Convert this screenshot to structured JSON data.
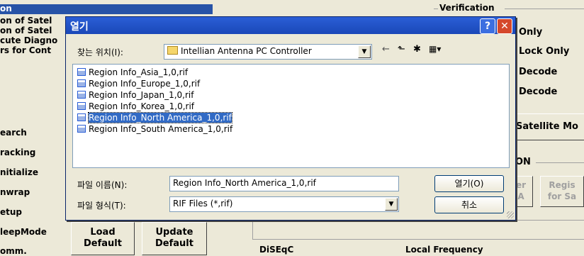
{
  "background": {
    "left_panel": {
      "highlight_text": "on",
      "items": [
        "on of Satel",
        "on of Satel",
        "cute Diagno",
        "rs for Cont",
        "earch",
        "racking",
        "nitialize",
        "nwrap",
        "etup",
        "leepMode",
        "omm."
      ]
    },
    "verification": {
      "group_label": "Verification",
      "options": [
        "Only",
        "Lock Only",
        "Decode",
        "Decode"
      ]
    },
    "satellite_mode_button": "Satellite Mo",
    "on_group_label": "ON",
    "disabled_buttons": [
      {
        "line1": "er",
        "line2": "A"
      },
      {
        "line1": "Regis",
        "line2": "for Sa"
      }
    ],
    "load_default": "Load Default",
    "update_default": "Update Default",
    "diseqc_label": "DiSEqC",
    "local_frequency_label": "Local Frequency"
  },
  "dialog": {
    "title": "열기",
    "help_glyph": "?",
    "close_glyph": "✕",
    "look_in_label": "찾는 위치(I):",
    "look_in_value": "Intellian Antenna PC Controller",
    "toolbar": {
      "back_icon": "←",
      "up_icon": "⬑",
      "new_folder_icon": "✱",
      "view_menu_icon": "▦▾"
    },
    "files": [
      "Region Info_Asia_1,0,rif",
      "Region Info_Europe_1,0,rif",
      "Region Info_Japan_1,0,rif",
      "Region Info_Korea_1,0,rif",
      "Region Info_North America_1,0,rif",
      "Region Info_South America_1,0,rif"
    ],
    "selected_index": 4,
    "filename_label": "파일 이름(N):",
    "filename_value": "Region Info_North America_1,0,rif",
    "filetype_label": "파일 형식(T):",
    "filetype_value": "RIF Files (*,rif)",
    "open_button": "열기(O)",
    "cancel_button": "취소"
  }
}
